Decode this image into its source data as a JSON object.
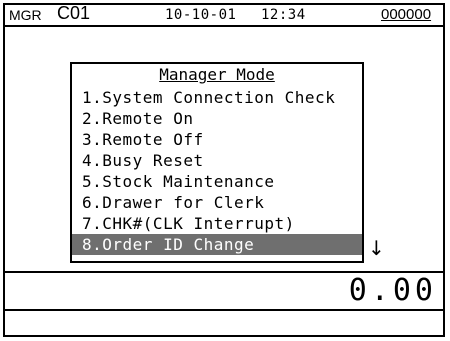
{
  "status_bar": {
    "mode": "MGR",
    "clerk": "C01",
    "date": "10-10-01",
    "time": "12:34",
    "counter": "000000"
  },
  "menu": {
    "title": "Manager Mode",
    "items": [
      "1.System Connection Check",
      "2.Remote On",
      "3.Remote Off",
      "4.Busy Reset",
      "5.Stock Maintenance",
      "6.Drawer for Clerk",
      "7.CHK#(CLK Interrupt)",
      "8.Order ID Change"
    ],
    "selected_index": 7,
    "scroll_indicator": "↓"
  },
  "amount": "0.00",
  "colors": {
    "selection_bg": "#6f6f6f",
    "selection_fg": "#ffffff",
    "foreground": "#000000",
    "background": "#ffffff"
  }
}
